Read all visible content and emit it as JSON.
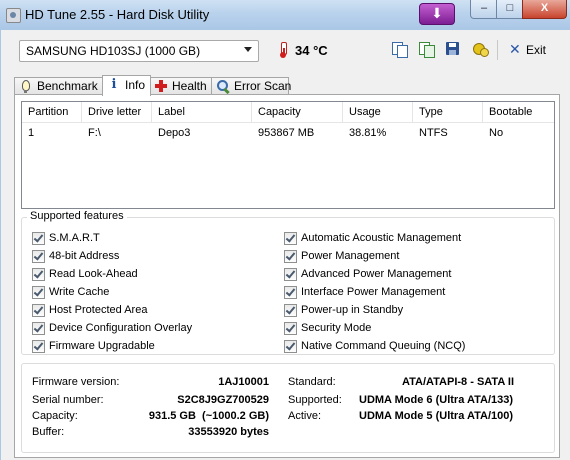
{
  "window": {
    "title": "HD Tune 2.55 - Hard Disk Utility",
    "download_glyph": "⬇",
    "minimize_glyph": "–",
    "maximize_glyph": "□",
    "close_glyph": "X"
  },
  "toolbar": {
    "drive_selected": "SAMSUNG HD103SJ (1000 GB)",
    "temperature": "34 °C",
    "exit_label": "Exit",
    "icons": [
      "thermometer-icon",
      "copy-icon",
      "copy-all-icon",
      "save-icon",
      "options-icon",
      "exit-icon"
    ]
  },
  "tabs": [
    {
      "label": "Benchmark",
      "icon": "benchmark-icon"
    },
    {
      "label": "Info",
      "icon": "info-icon",
      "active": true
    },
    {
      "label": "Health",
      "icon": "health-icon"
    },
    {
      "label": "Error Scan",
      "icon": "error-scan-icon"
    }
  ],
  "partitions": {
    "columns": [
      "Partition",
      "Drive letter",
      "Label",
      "Capacity",
      "Usage",
      "Type",
      "Bootable"
    ],
    "rows": [
      [
        "1",
        "F:\\",
        "Depo3",
        "953867 MB",
        "38.81%",
        "NTFS",
        "No"
      ]
    ]
  },
  "features": {
    "title": "Supported features",
    "left": [
      {
        "label": "S.M.A.R.T",
        "checked": true
      },
      {
        "label": "48-bit Address",
        "checked": true
      },
      {
        "label": "Read Look-Ahead",
        "checked": true
      },
      {
        "label": "Write Cache",
        "checked": true
      },
      {
        "label": "Host Protected Area",
        "checked": true
      },
      {
        "label": "Device Configuration Overlay",
        "checked": true
      },
      {
        "label": "Firmware Upgradable",
        "checked": true
      }
    ],
    "right": [
      {
        "label": "Automatic Acoustic Management",
        "checked": true
      },
      {
        "label": "Power Management",
        "checked": true
      },
      {
        "label": "Advanced Power Management",
        "checked": true
      },
      {
        "label": "Interface Power Management",
        "checked": true
      },
      {
        "label": "Power-up in Standby",
        "checked": true
      },
      {
        "label": "Security Mode",
        "checked": true
      },
      {
        "label": "Native Command Queuing (NCQ)",
        "checked": true
      }
    ]
  },
  "details": {
    "firmware_label": "Firmware version:",
    "firmware_value": "1AJ10001",
    "serial_label": "Serial number:",
    "serial_value": "S2C8J9GZ700529",
    "capacity_label": "Capacity:",
    "capacity_value": "931.5 GB  (~1000.2 GB)",
    "buffer_label": "Buffer:",
    "buffer_value": "33553920 bytes",
    "standard_label": "Standard:",
    "standard_value": "ATA/ATAPI-8 - SATA II",
    "supported_label": "Supported:",
    "supported_value": "UDMA Mode 6 (Ultra ATA/133)",
    "active_label": "Active:",
    "active_value": "UDMA Mode 5 (Ultra ATA/100)"
  }
}
